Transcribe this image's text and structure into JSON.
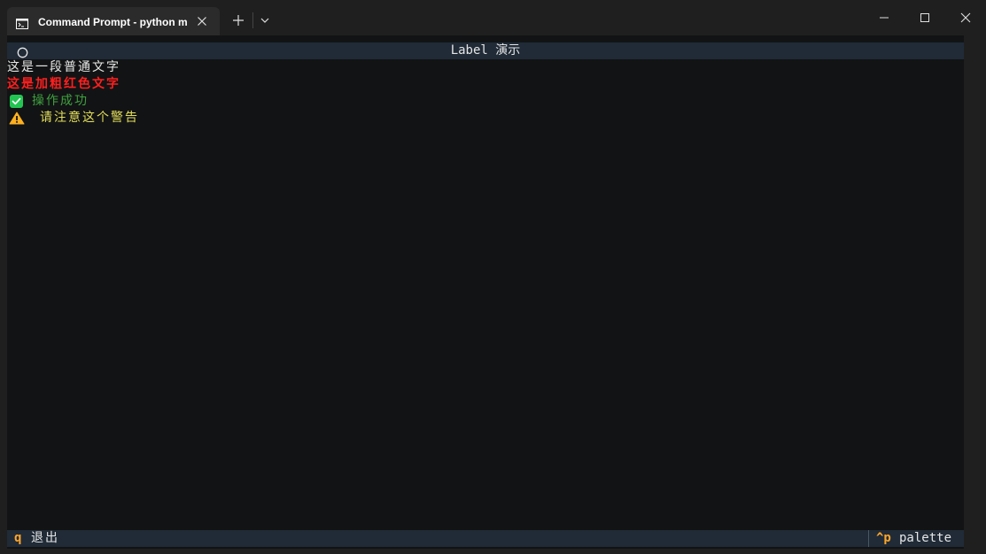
{
  "window": {
    "tab_title": "Command Prompt - python m",
    "tab_icon": "terminal-icon",
    "buttons": {
      "new_tab": "plus-icon",
      "dropdown": "chevron-down-icon",
      "minimize": "minimize-icon",
      "maximize": "maximize-icon",
      "close": "close-icon"
    }
  },
  "app": {
    "header_title": "Label 演示",
    "header_icon": "circle-icon",
    "labels": {
      "plain": "这是一段普通文字",
      "bold_red": "这是加粗红色文字",
      "success": "操作成功",
      "success_icon": "check-box-icon",
      "warning": "请注意这个警告",
      "warning_icon": "warning-icon"
    },
    "footer": {
      "quit_key": "q",
      "quit_label": "退出",
      "palette_key": "^p",
      "palette_label": "palette"
    }
  },
  "colors": {
    "terminal_bg": "#121314",
    "bar_bg": "#202b37",
    "red_text": "#ff1f1f",
    "success_text": "#3fa13f",
    "check_bg": "#23c552",
    "warning_text": "#e3de5a",
    "warning_icon": "#ffb020",
    "key_accent": "#ffa62b"
  }
}
